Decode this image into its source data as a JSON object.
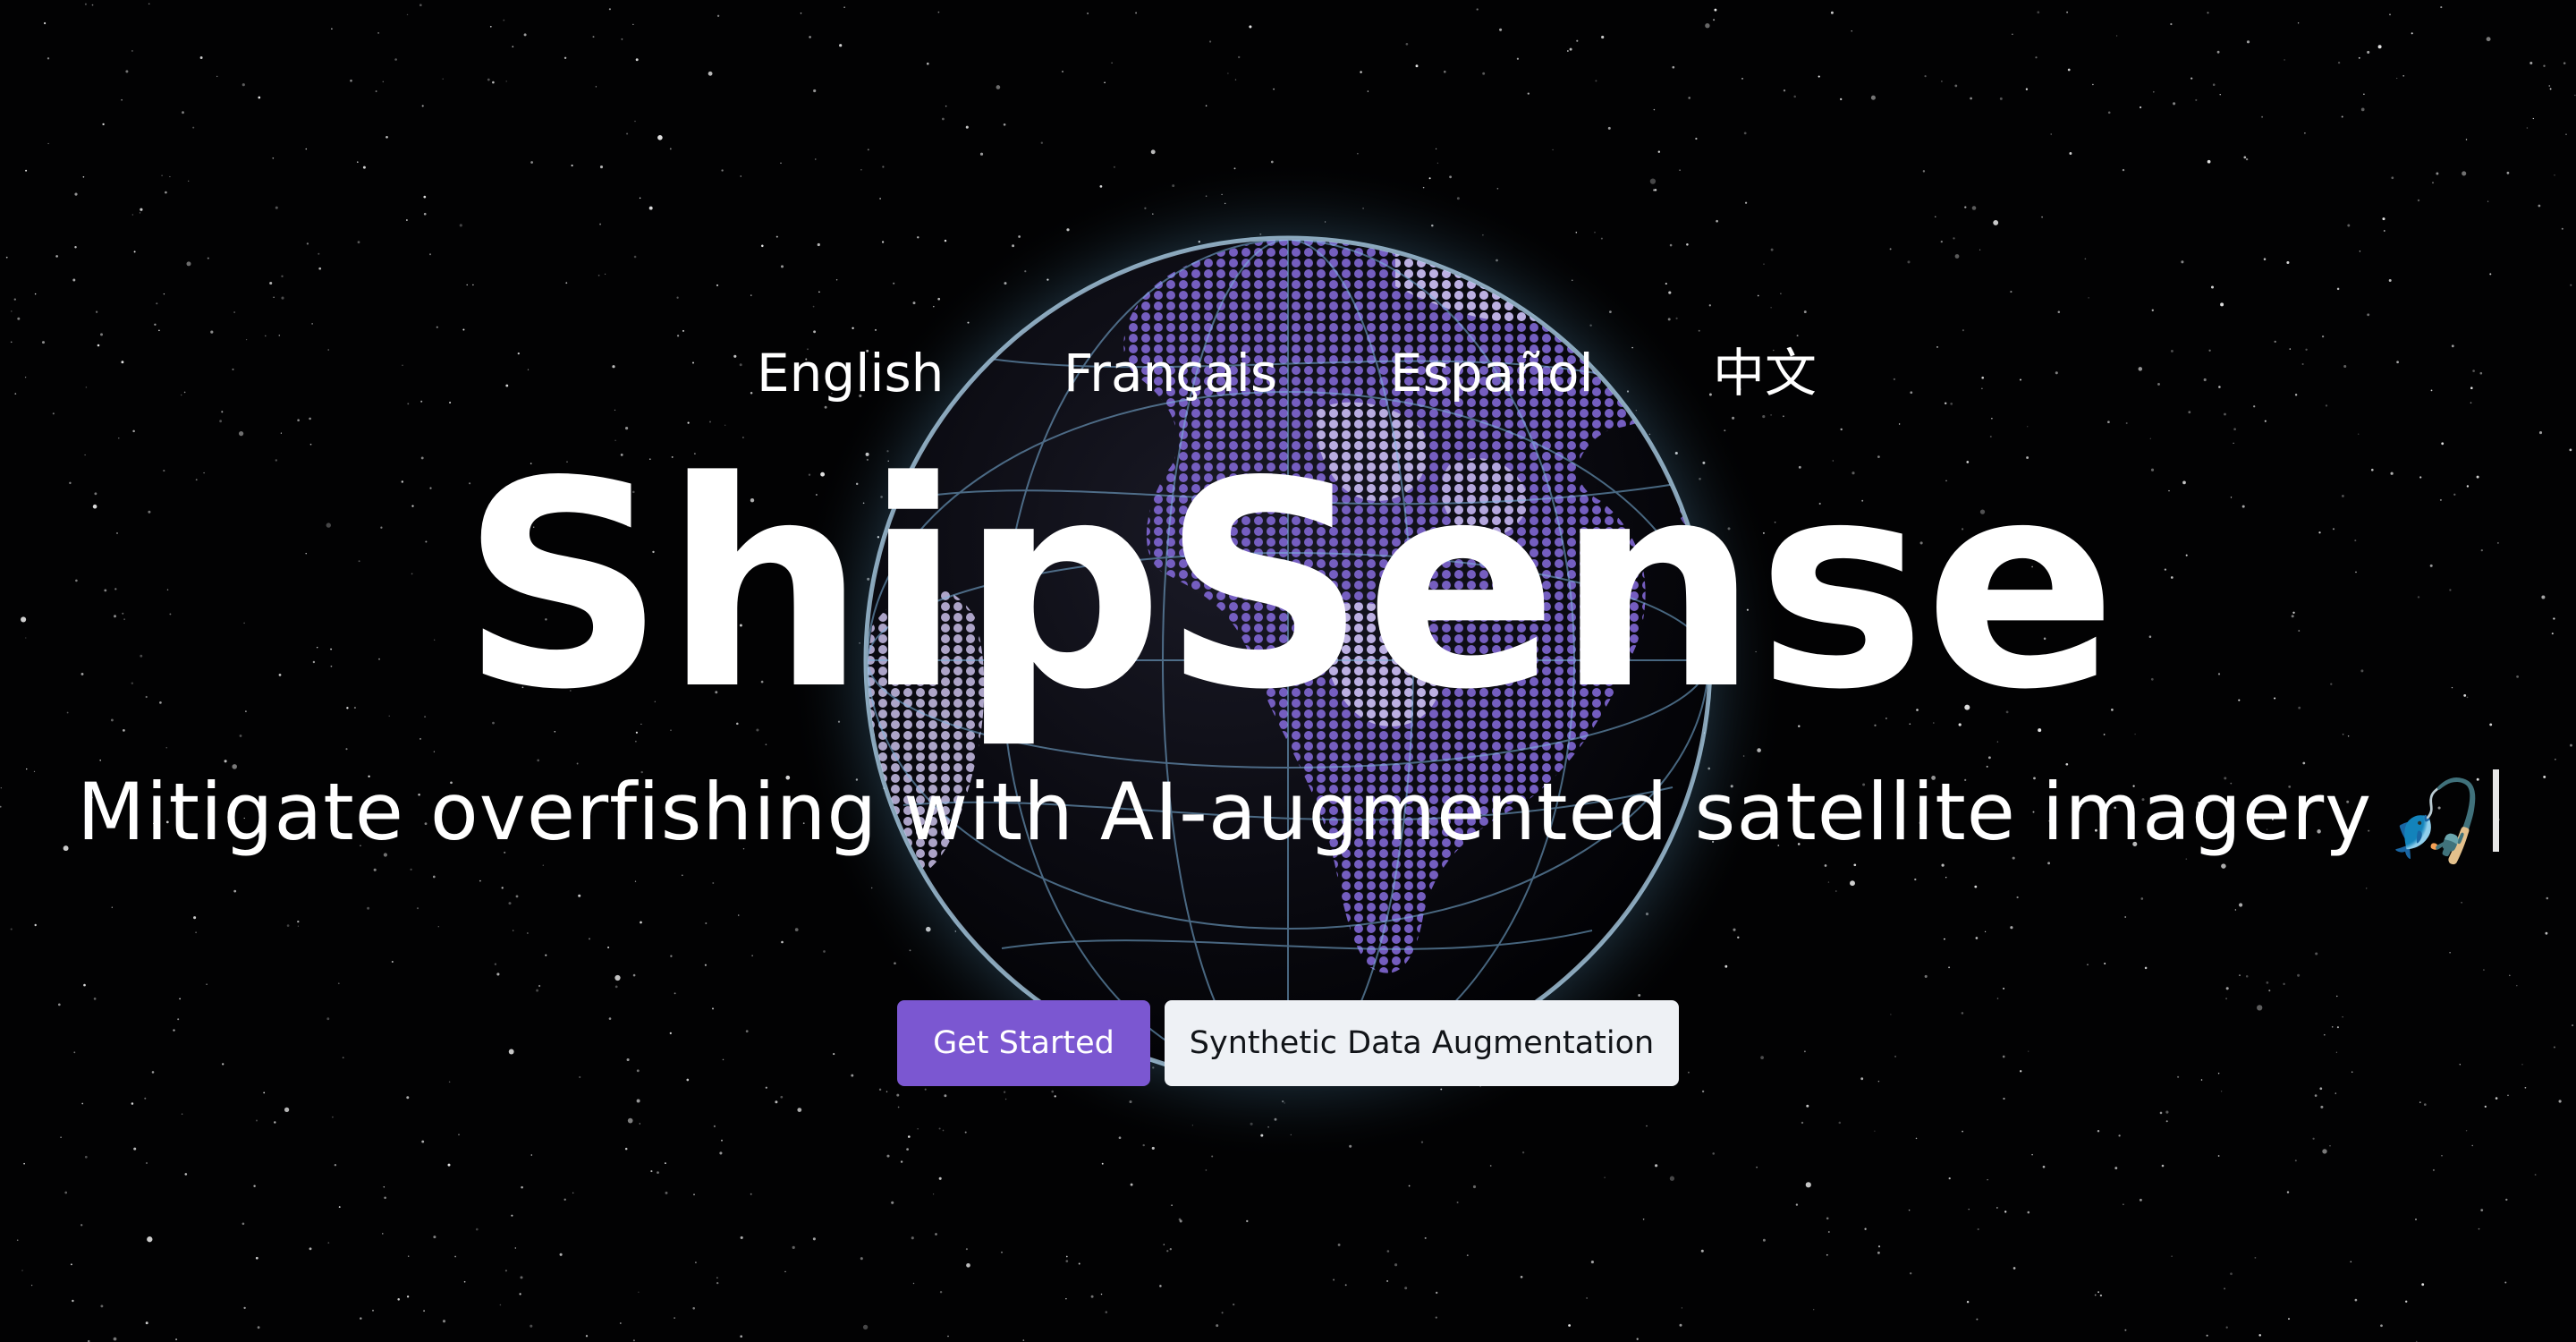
{
  "languages": [
    {
      "label": "English"
    },
    {
      "label": "Français"
    },
    {
      "label": "Español"
    },
    {
      "label": "中文"
    }
  ],
  "hero": {
    "title": "ShipSense",
    "tagline": "Mitigate overfishing with AI-augmented satellite imagery",
    "emoji": "🎣"
  },
  "actions": {
    "primary_label": "Get Started",
    "secondary_label": "Synthetic Data Augmentation"
  },
  "colors": {
    "background": "#020203",
    "accent": "#7b57d1",
    "secondary_button": "#eef1f5",
    "globe_land": "#6c54b8",
    "globe_glow": "#9ad8ff"
  },
  "icons": {
    "globe": "globe-icon",
    "fishing_rod": "fishing-pole-icon"
  }
}
